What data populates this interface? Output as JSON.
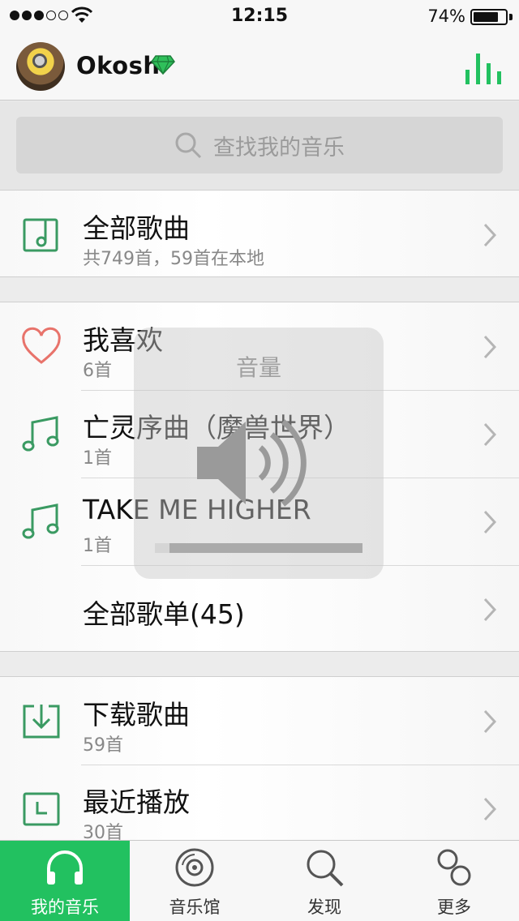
{
  "status_bar": {
    "time": "12:15",
    "battery": "74%"
  },
  "header": {
    "username": "Okosh"
  },
  "search": {
    "placeholder": "查找我的音乐"
  },
  "section1": {
    "all_songs_title": "全部歌曲",
    "all_songs_sub": "共749首，59首在本地"
  },
  "playlists": [
    {
      "title": "我喜欢",
      "sub": "6首"
    },
    {
      "title": "亡灵序曲（魔兽世界）",
      "sub": "1首"
    },
    {
      "title": "TAKE ME HIGHER",
      "sub": "1首"
    },
    {
      "title": "全部歌单(45)"
    }
  ],
  "section3": [
    {
      "title": "下载歌曲",
      "sub": "59首"
    },
    {
      "title": "最近播放",
      "sub": "30首"
    }
  ],
  "volume_hud": {
    "title": "音量",
    "level": 0.07
  },
  "tabs": [
    {
      "label": "我的音乐"
    },
    {
      "label": "音乐馆"
    },
    {
      "label": "发现"
    },
    {
      "label": "更多"
    }
  ],
  "colors": {
    "accent": "#22c160",
    "heart": "#e8736b",
    "icon_green": "#3a9a62"
  }
}
